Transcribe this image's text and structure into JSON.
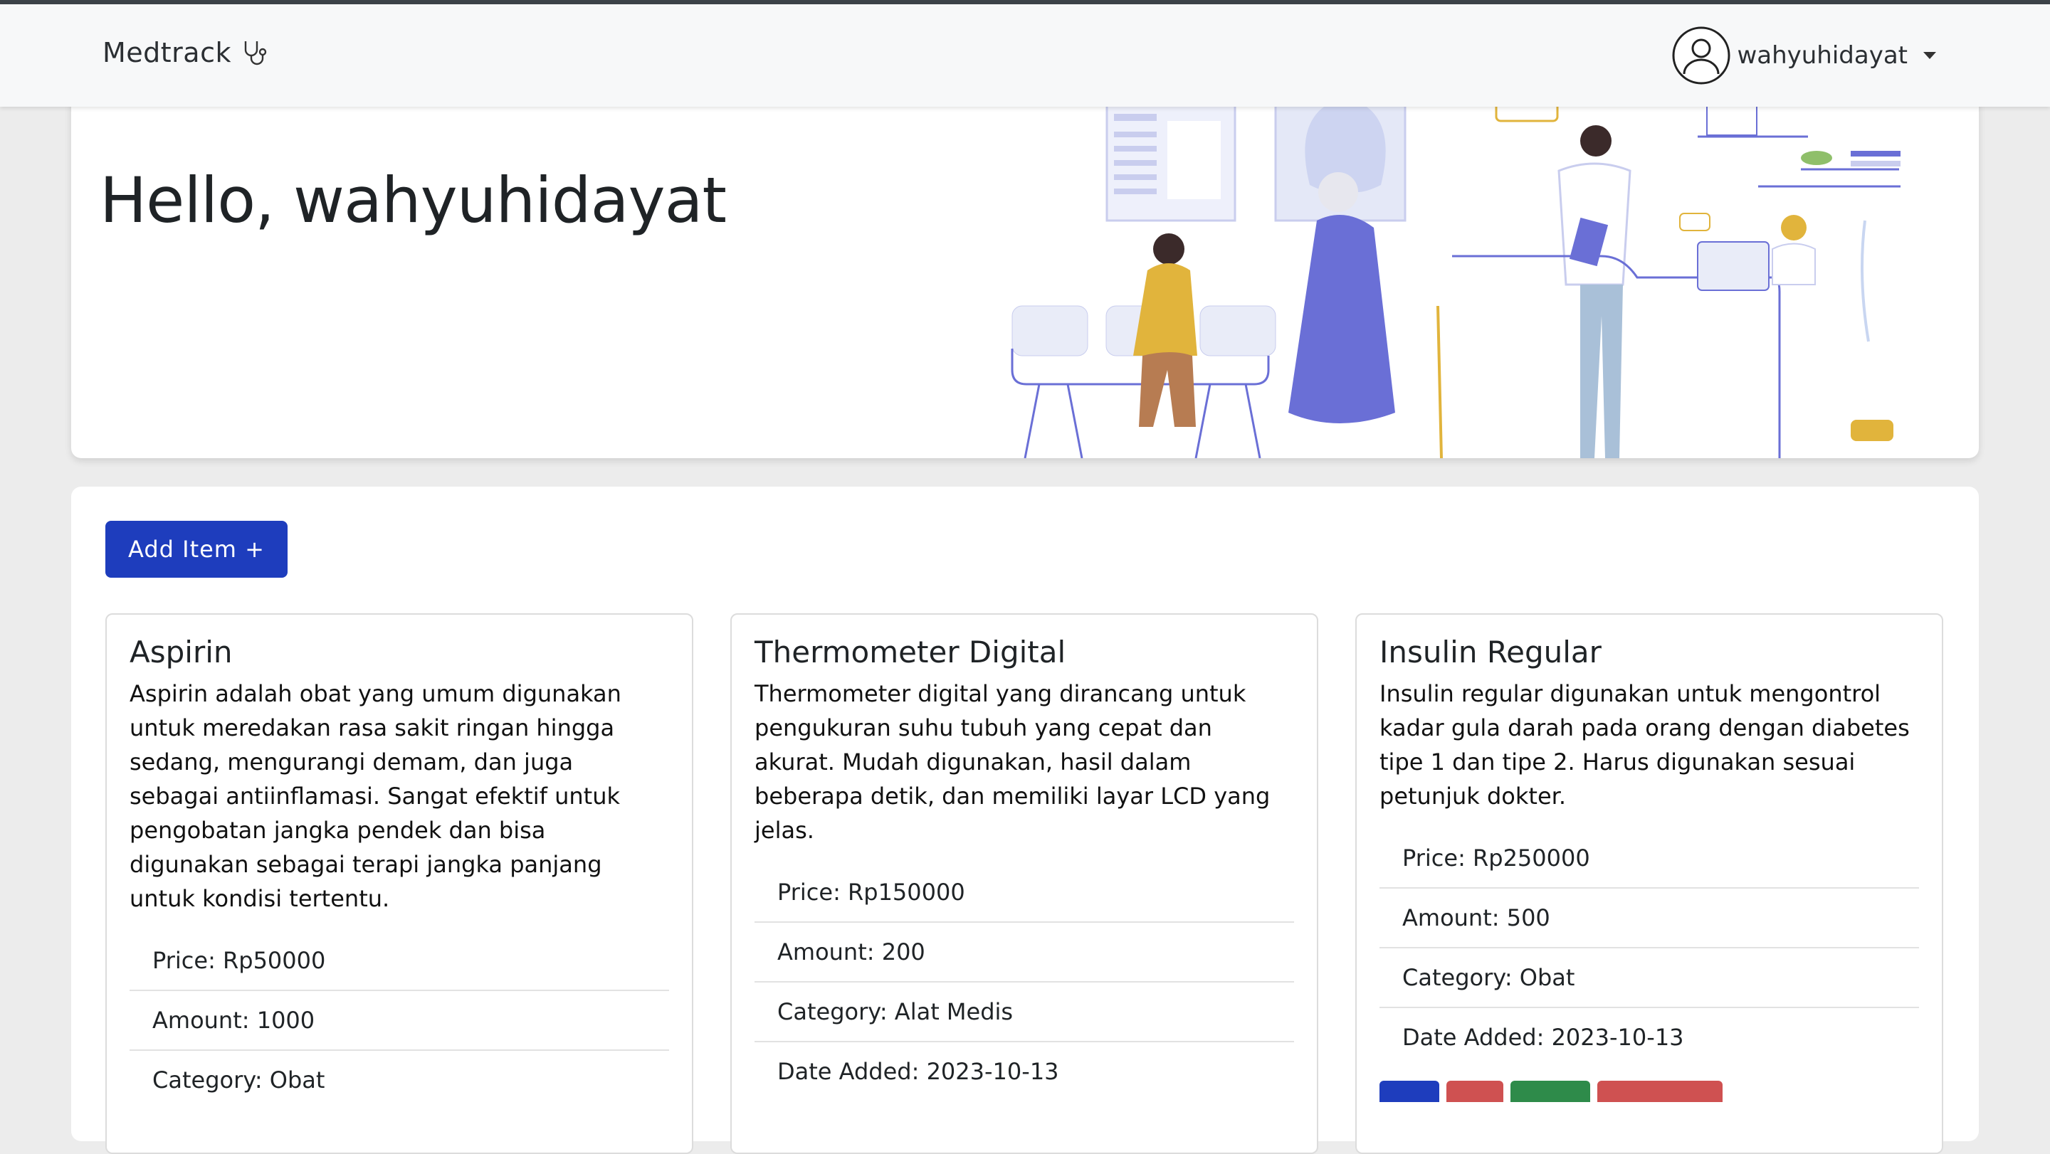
{
  "navbar": {
    "brand": "Medtrack",
    "username": "wahyuhidayat"
  },
  "hero": {
    "greeting": "Hello, wahyuhidayat"
  },
  "actions": {
    "add_item_label": "Add Item +"
  },
  "items": [
    {
      "name": "Aspirin",
      "description": "Aspirin adalah obat yang umum digunakan untuk meredakan rasa sakit ringan hingga sedang, mengurangi demam, dan juga sebagai antiinflamasi. Sangat efektif untuk pengobatan jangka pendek dan bisa digunakan sebagai terapi jangka panjang untuk kondisi tertentu.",
      "price": "Price: Rp50000",
      "amount": "Amount: 1000",
      "category": "Category: Obat"
    },
    {
      "name": "Thermometer Digital",
      "description": "Thermometer digital yang dirancang untuk pengukuran suhu tubuh yang cepat dan akurat. Mudah digunakan, hasil dalam beberapa detik, dan memiliki layar LCD yang jelas.",
      "price": "Price: Rp150000",
      "amount": "Amount: 200",
      "category": "Category: Alat Medis",
      "date_added": "Date Added: 2023-10-13"
    },
    {
      "name": "Insulin Regular",
      "description": "Insulin regular digunakan untuk mengontrol kadar gula darah pada orang dengan diabetes tipe 1 dan tipe 2. Harus digunakan sesuai petunjuk dokter.",
      "price": "Price: Rp250000",
      "amount": "Amount: 500",
      "category": "Category: Obat",
      "date_added": "Date Added: 2023-10-13"
    }
  ],
  "colors": {
    "primary": "#1e3dbd",
    "danger": "#cf5151",
    "success": "#2e8b4a",
    "illustration_accent": "#6a6fd6",
    "illustration_yellow": "#e1b43c"
  }
}
